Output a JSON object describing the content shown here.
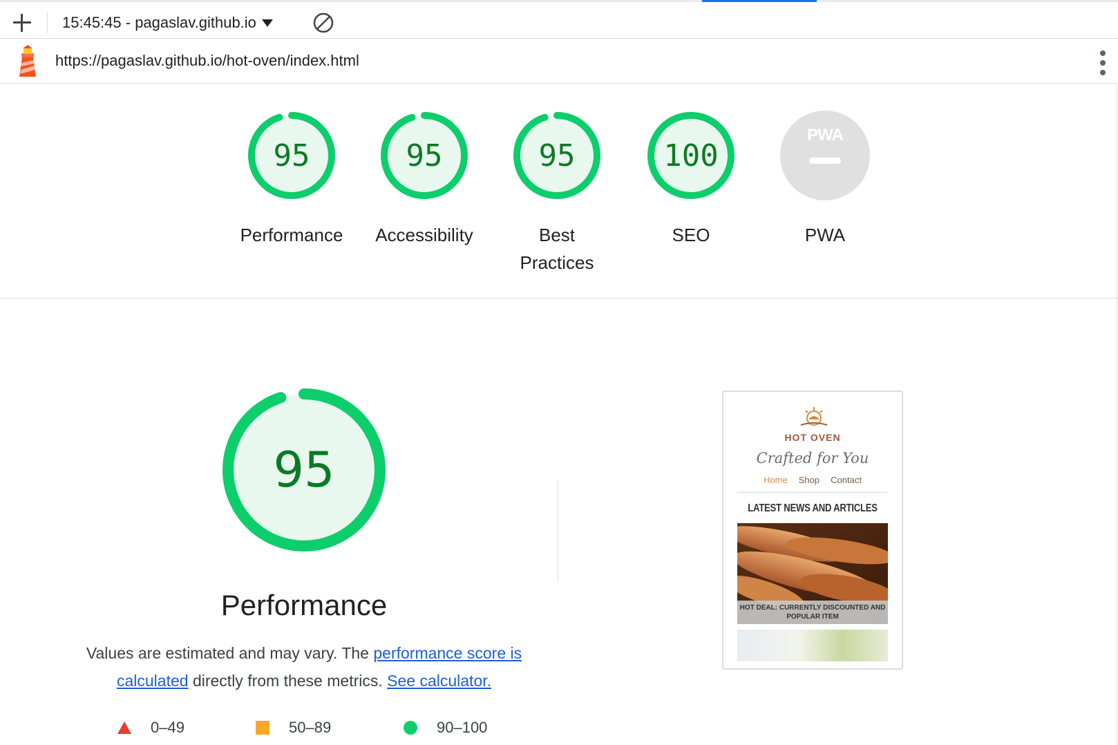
{
  "toolbar": {
    "report_selector": "15:45:45 - pagaslav.github.io"
  },
  "urlbar": {
    "url": "https://pagaslav.github.io/hot-oven/index.html"
  },
  "scores": [
    {
      "label": "Performance",
      "value": "95",
      "score": 0.95
    },
    {
      "label": "Accessibility",
      "value": "95",
      "score": 0.95
    },
    {
      "label": "Best Practices",
      "value": "95",
      "score": 0.95
    },
    {
      "label": "SEO",
      "value": "100",
      "score": 1.0
    },
    {
      "label": "PWA",
      "badge_text": "PWA",
      "score": null
    }
  ],
  "performance": {
    "value": "95",
    "score": 0.95,
    "title": "Performance",
    "desc_1": "Values are estimated and may vary. The ",
    "link_score": "performance score is calculated",
    "desc_2": " directly from these metrics. ",
    "link_calculator": "See calculator."
  },
  "legend": [
    {
      "range": "0–49"
    },
    {
      "range": "50–89"
    },
    {
      "range": "90–100"
    }
  ],
  "thumbnail": {
    "brand": "HOT OVEN",
    "tagline": "Crafted for You",
    "nav": [
      "Home",
      "Shop",
      "Contact"
    ],
    "heading": "LATEST NEWS AND ARTICLES",
    "caption": "HOT DEAL: CURRENTLY DISCOUNTED AND POPULAR ITEM"
  },
  "colors": {
    "pass": "#0cce6b",
    "pass_text": "#0c7a24",
    "pass_bg": "#e8f8ef",
    "average": "#f9a825",
    "fail": "#eb3b2b",
    "link": "#1a5fd6"
  }
}
